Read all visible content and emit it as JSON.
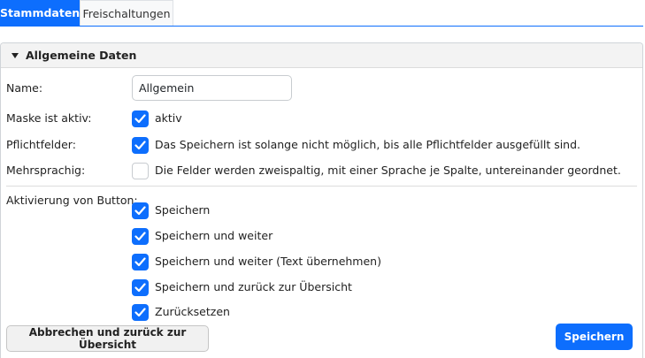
{
  "tabs": [
    {
      "label": "Stammdaten",
      "active": true
    },
    {
      "label": "Freischaltungen",
      "active": false
    }
  ],
  "panel": {
    "title": "Allgemeine Daten",
    "expanded": true
  },
  "form": {
    "name": {
      "label": "Name:",
      "value": "Allgemein"
    },
    "maske_aktiv": {
      "label": "Maske ist aktiv:",
      "checked": true,
      "text": "aktiv"
    },
    "pflichtfelder": {
      "label": "Pflichtfelder:",
      "checked": true,
      "text": "Das Speichern ist solange nicht möglich, bis alle Pflichtfelder ausgefüllt sind."
    },
    "mehrsprachig": {
      "label": "Mehrsprachig:",
      "checked": false,
      "text": "Die Felder werden zweispaltig, mit einer Sprache je Spalte, untereinander geordnet."
    },
    "aktivierung": {
      "label": "Aktivierung von Button:",
      "options": [
        {
          "text": "Speichern",
          "checked": true
        },
        {
          "text": "Speichern und weiter",
          "checked": true
        },
        {
          "text": "Speichern und weiter (Text übernehmen)",
          "checked": true
        },
        {
          "text": "Speichern und zurück zur Übersicht",
          "checked": true
        },
        {
          "text": "Zurücksetzen",
          "checked": true
        }
      ]
    }
  },
  "actions": {
    "cancel_label": "Abbrechen und zurück zur Übersicht",
    "save_label": "Speichern"
  },
  "colors": {
    "accent": "#0d6efd"
  }
}
